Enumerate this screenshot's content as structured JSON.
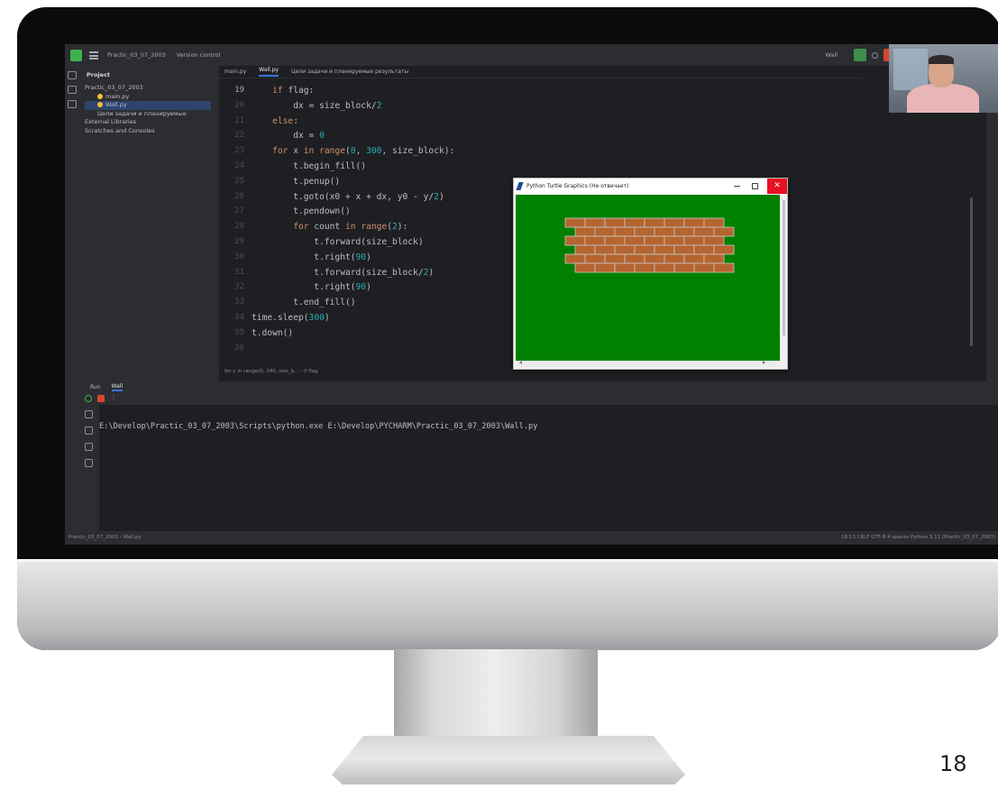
{
  "titlebar": {
    "project_name": "Practic_03_07_2003",
    "vcs": "Version control",
    "run_config": "Wall"
  },
  "project_panel": {
    "title": "Project",
    "items": [
      {
        "label": "Practic_03_07_2003",
        "indent": 0
      },
      {
        "label": "main.py",
        "indent": 1
      },
      {
        "label": "Wall.py",
        "indent": 1,
        "selected": true
      },
      {
        "label": "Цели задачи и планируемые",
        "indent": 1
      },
      {
        "label": "External Libraries",
        "indent": 0
      },
      {
        "label": "Scratches and Consoles",
        "indent": 0
      }
    ]
  },
  "editor_tabs": [
    {
      "label": "main.py",
      "active": false
    },
    {
      "label": "Wall.py",
      "active": true
    },
    {
      "label": "Цели задачи и планируемые результаты",
      "active": false
    }
  ],
  "editor": {
    "first_line_number": "19",
    "lines": [
      [
        {
          "t": "    "
        },
        {
          "t": "if",
          "k": "kw"
        },
        {
          "t": " flag:"
        }
      ],
      [
        {
          "t": "        dx = size_block/"
        },
        {
          "t": "2",
          "k": "num"
        }
      ],
      [
        {
          "t": "    "
        },
        {
          "t": "else",
          "k": "kw"
        },
        {
          "t": ":"
        }
      ],
      [
        {
          "t": "        dx = "
        },
        {
          "t": "0",
          "k": "num"
        }
      ],
      [
        {
          "t": "    "
        },
        {
          "t": "for",
          "k": "kw"
        },
        {
          "t": " x "
        },
        {
          "t": "in",
          "k": "kw"
        },
        {
          "t": " "
        },
        {
          "t": "range",
          "k": "kw"
        },
        {
          "t": "("
        },
        {
          "t": "0",
          "k": "num"
        },
        {
          "t": ", "
        },
        {
          "t": "300",
          "k": "num"
        },
        {
          "t": ", size_block):"
        }
      ],
      [
        {
          "t": "        t.begin_fill()"
        }
      ],
      [
        {
          "t": "        t.penup()"
        }
      ],
      [
        {
          "t": "        t.goto(x0 + x + dx, y0 - y/"
        },
        {
          "t": "2",
          "k": "num"
        },
        {
          "t": ")"
        }
      ],
      [
        {
          "t": "        t.pendown()"
        }
      ],
      [
        {
          "t": "        "
        },
        {
          "t": "for",
          "k": "kw"
        },
        {
          "t": " count "
        },
        {
          "t": "in",
          "k": "kw"
        },
        {
          "t": " "
        },
        {
          "t": "range",
          "k": "kw"
        },
        {
          "t": "("
        },
        {
          "t": "2",
          "k": "num"
        },
        {
          "t": "):"
        }
      ],
      [
        {
          "t": "            t.forward(size_block)"
        }
      ],
      [
        {
          "t": "            t.right("
        },
        {
          "t": "90",
          "k": "num"
        },
        {
          "t": ")"
        }
      ],
      [
        {
          "t": "            t.forward(size_block/"
        },
        {
          "t": "2",
          "k": "num"
        },
        {
          "t": ")"
        }
      ],
      [
        {
          "t": "            t.right("
        },
        {
          "t": "90",
          "k": "num"
        },
        {
          "t": ")"
        }
      ],
      [
        {
          "t": "        t.end_fill()"
        }
      ],
      [
        {
          "t": "time.sleep("
        },
        {
          "t": "300",
          "k": "num"
        },
        {
          "t": ")"
        }
      ],
      [
        {
          "t": "t.down()"
        }
      ],
      [
        {
          "t": ""
        }
      ]
    ],
    "breadcrumb": "for y in range(0, 240, size_b... › if flag"
  },
  "turtle_window": {
    "title": "Python Turtle Graphics (Не отвечает)",
    "close_glyph": "✕",
    "background_color": "#008000",
    "brick_color": "#b5652f",
    "mortar_color": "#c9c9c9",
    "rows": 6,
    "bricks_per_row": 8
  },
  "run_panel": {
    "tab_label": "Run",
    "config_tab": "Wall",
    "more_glyph": "⋮",
    "console_line": "E:\\Develop\\Practic_03_07_2003\\Scripts\\python.exe E:\\Develop\\PYCHARM\\Practic_03_07_2003\\Wall.py"
  },
  "statusbar": {
    "left": "Practic_03_07_2003 › Wall.py",
    "right": "18:13   CRLF   UTF-8   4 spaces   Python 3.11 (Practic_03_07_2003)"
  },
  "page_number": "18"
}
